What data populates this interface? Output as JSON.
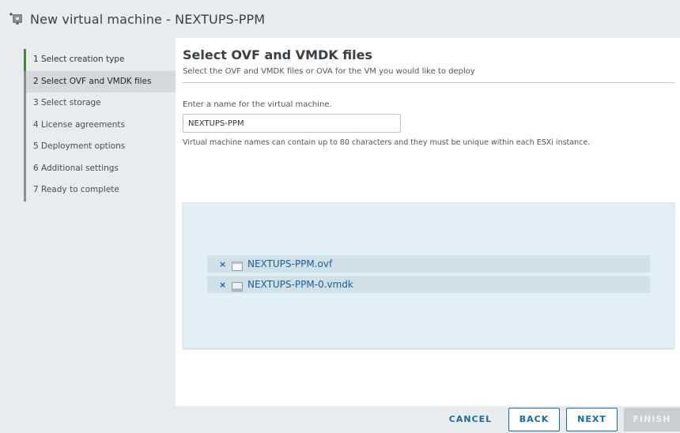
{
  "window": {
    "title": "New virtual machine - NEXTUPS-PPM",
    "icon": "add-vm-icon"
  },
  "sidebar": {
    "steps": [
      {
        "label": "1  Select creation type",
        "state": "done"
      },
      {
        "label": "2  Select OVF and VMDK files",
        "state": "active"
      },
      {
        "label": "3  Select storage",
        "state": "pending"
      },
      {
        "label": "4  License agreements",
        "state": "pending"
      },
      {
        "label": "5  Deployment options",
        "state": "pending"
      },
      {
        "label": "6  Additional settings",
        "state": "pending"
      },
      {
        "label": "7  Ready to complete",
        "state": "pending"
      }
    ]
  },
  "main": {
    "heading": "Select OVF and VMDK files",
    "subtitle": "Select the OVF and VMDK files or OVA for the VM you would like to deploy",
    "name_label": "Enter a name for the virtual machine.",
    "name_value": "NEXTUPS-PPM",
    "help_text": "Virtual machine names can contain up to 80 characters and they must be unique within each ESXi instance.",
    "files": [
      {
        "name": "NEXTUPS-PPM.ovf",
        "remove_glyph": "×",
        "icon": "ovf-file-icon"
      },
      {
        "name": "NEXTUPS-PPM-0.vmdk",
        "remove_glyph": "×",
        "icon": "vmdk-disk-icon"
      }
    ]
  },
  "footer": {
    "cancel": "CANCEL",
    "back": "BACK",
    "next": "NEXT",
    "finish": "FINISH"
  },
  "colors": {
    "accent": "#1a6a9a",
    "done_step": "#3e8a2c",
    "dropzone_bg": "#e0f0f6"
  }
}
